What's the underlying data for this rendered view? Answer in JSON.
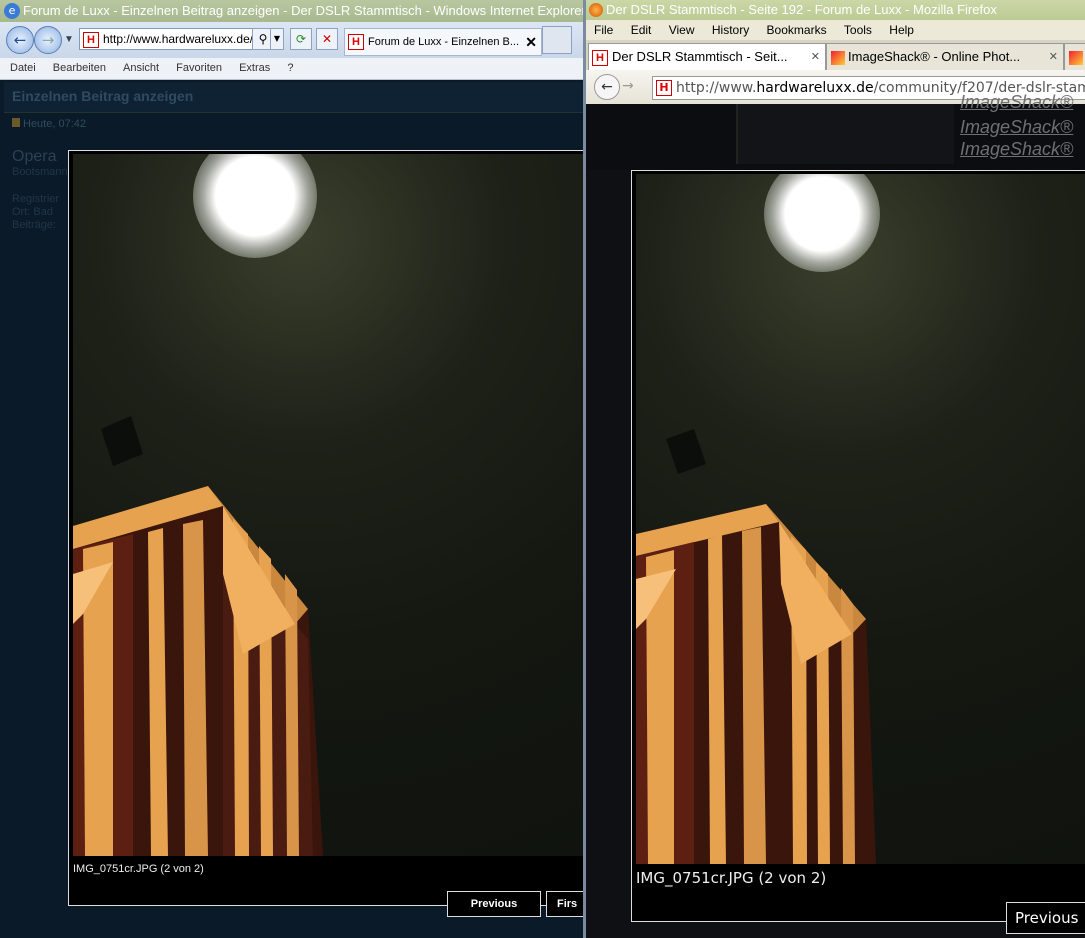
{
  "ie": {
    "title": "Forum de Luxx - Einzelnen Beitrag anzeigen - Der DSLR Stammtisch - Windows Internet Explorer",
    "url": "http://www.hardwareluxx.de/",
    "tab": "Forum de Luxx - Einzelnen B...",
    "menu": [
      "Datei",
      "Bearbeiten",
      "Ansicht",
      "Favoriten",
      "Extras",
      "?"
    ],
    "forum_header": "Einzelnen Beitrag anzeigen",
    "date": "Heute, 07:42",
    "username": "Opera",
    "user_info": [
      "Bootsmann",
      "Registrier",
      "Ort: Bad",
      "Beiträge:"
    ],
    "lightbox": {
      "caption": "IMG_0751cr.JPG (2 von 2)",
      "prev_label": "Previous",
      "first_label": "Firs"
    }
  },
  "ff": {
    "title": "Der DSLR Stammtisch - Seite 192 - Forum de Luxx - Mozilla Firefox",
    "menu": [
      "File",
      "Edit",
      "View",
      "History",
      "Bookmarks",
      "Tools",
      "Help"
    ],
    "tabs": [
      "Der DSLR Stammtisch - Seit...",
      "ImageShack® - Online Phot..."
    ],
    "url_prefix": "http://www.",
    "url_domain": "hardwareluxx.de",
    "url_path": "/community/f207/der-dslr-stam",
    "imageshack_links": [
      "ImageShack®",
      "ImageShack®",
      "ImageShack®"
    ],
    "lightbox": {
      "caption": "IMG_0751cr.JPG (2 von 2)",
      "prev_label": "Previous"
    }
  },
  "colors": {
    "tower_orange": "#e6a24f",
    "tower_red": "#7a1d12",
    "lightbox_border": "#dddddd"
  }
}
